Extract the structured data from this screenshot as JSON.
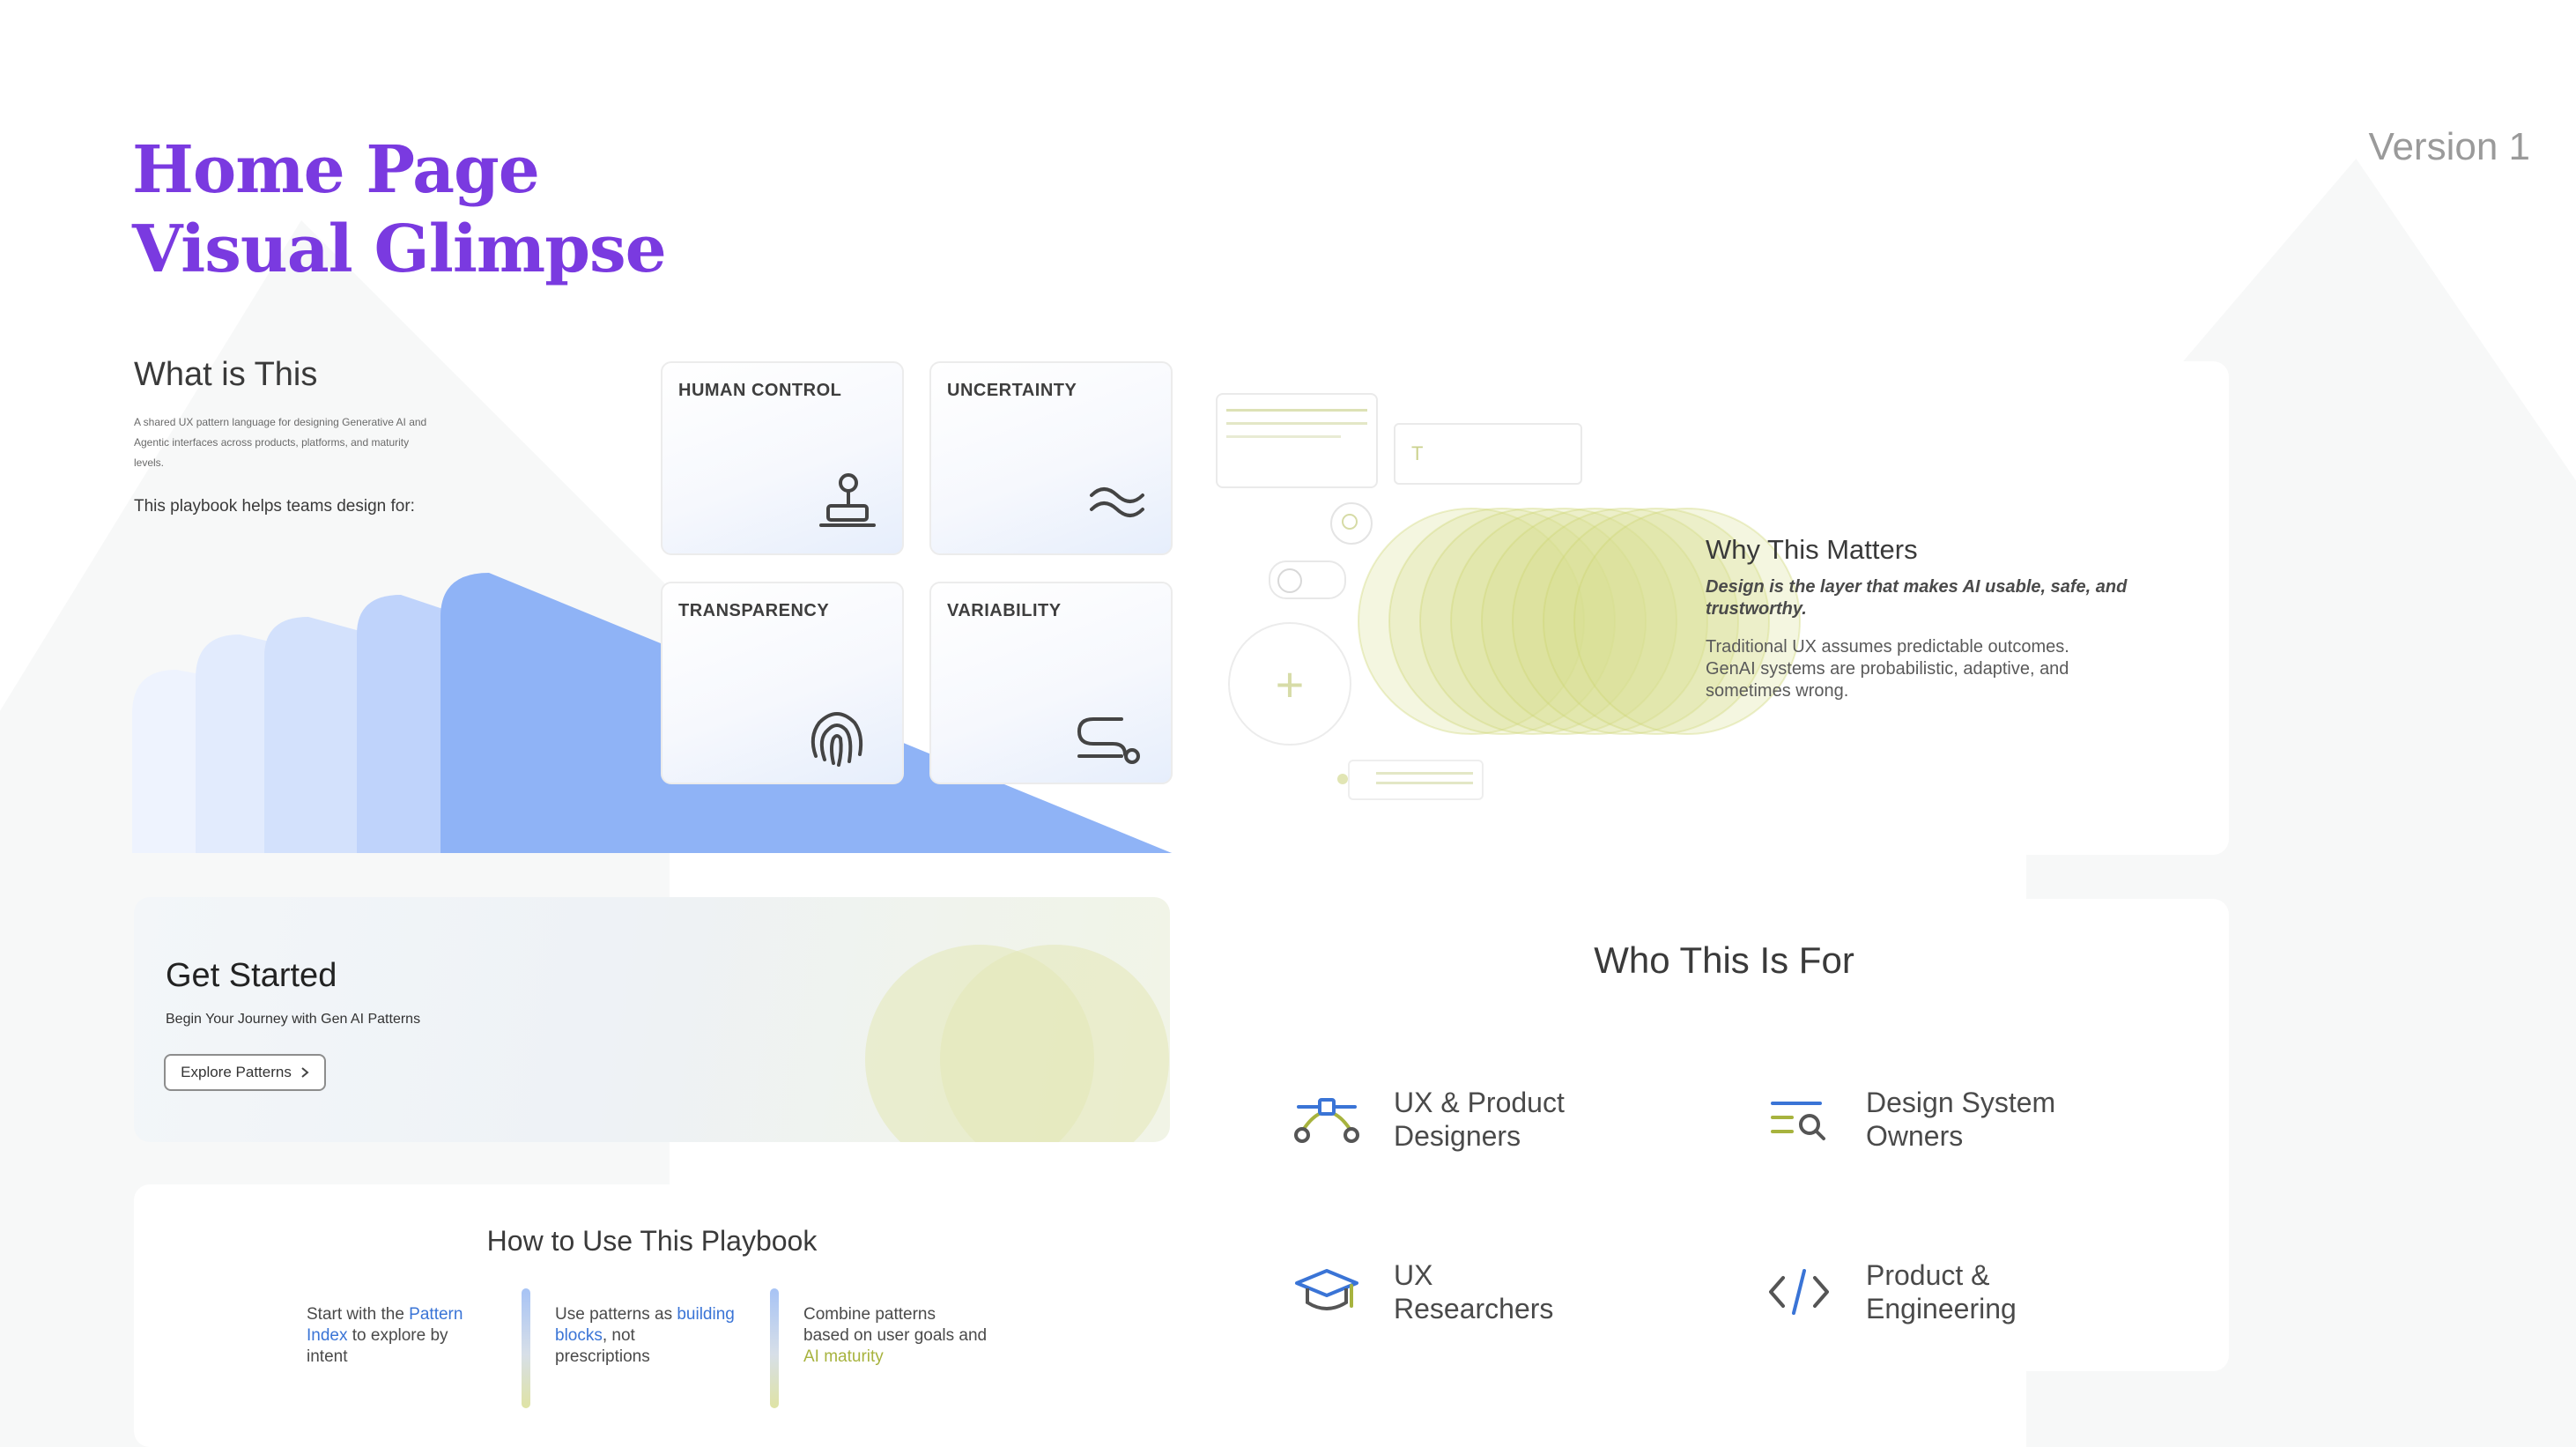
{
  "page": {
    "title_line1": "Home Page",
    "title_line2": "Visual Glimpse",
    "version": "Version 1"
  },
  "what_is_this": {
    "heading": "What is This",
    "description_line1": "A shared UX pattern language for designing Generative AI and",
    "description_line2": "Agentic interfaces across products, platforms, and maturity",
    "description_line3": "levels.",
    "helps": "This playbook helps teams design for:"
  },
  "principles": [
    {
      "label": "HUMAN CONTROL",
      "icon": "joystick-icon"
    },
    {
      "label": "UNCERTAINTY",
      "icon": "wave-icon"
    },
    {
      "label": "TRANSPARENCY",
      "icon": "fingerprint-icon"
    },
    {
      "label": "VARIABILITY",
      "icon": "path-icon"
    }
  ],
  "why": {
    "heading": "Why This Matters",
    "emphasis_line1": "Design is the layer that makes AI usable, safe, and",
    "emphasis_line2": "trustworthy.",
    "body_line1": "Traditional UX assumes predictable outcomes.",
    "body_line2": "GenAI systems are probabilistic, adaptive, and",
    "body_line3": "sometimes wrong.",
    "input_letter": "T"
  },
  "get_started": {
    "heading": "Get Started",
    "subheading": "Begin Your Journey with Gen AI Patterns",
    "button": "Explore Patterns",
    "button_icon": "chevron-right-icon"
  },
  "how_to": {
    "heading": "How to Use This Playbook",
    "steps": [
      {
        "pre": "Start with the ",
        "hl1": "Pattern",
        "hl2": "Index",
        "post": " to explore by",
        "post2": "intent"
      },
      {
        "pre": "Use patterns as ",
        "hl1": "building",
        "hl2": "blocks",
        "post": ", not",
        "post2": "prescriptions"
      },
      {
        "pre": "Combine patterns",
        "pre2": "based on user goals and",
        "hl1": "AI maturity"
      }
    ]
  },
  "who": {
    "heading": "Who This Is For",
    "items": [
      {
        "line1": "UX & Product",
        "line2": "Designers",
        "icon": "bezier-icon"
      },
      {
        "line1": "Design System",
        "line2": "Owners",
        "icon": "list-search-icon"
      },
      {
        "line1": "UX",
        "line2": "Researchers",
        "icon": "graduation-cap-icon"
      },
      {
        "line1": "Product &",
        "line2": "Engineering",
        "icon": "code-icon"
      }
    ]
  },
  "colors": {
    "title": "#7a3ae0",
    "accent_blue": "#3a74d6",
    "accent_green": "#a7b33e",
    "fan_blue": "#8fb3f6"
  }
}
